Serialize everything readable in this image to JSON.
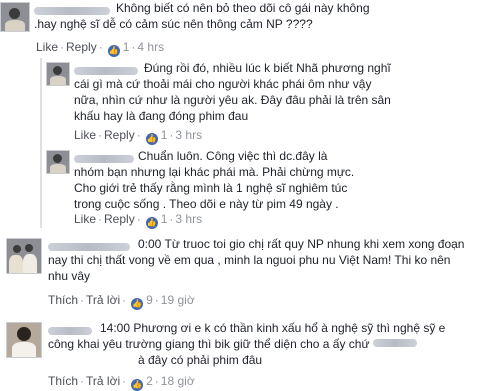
{
  "comments": [
    {
      "text": "Không biết có nên bỏ theo dõi cô gái này không .hay nghệ sĩ dễ có cảm súc nên thông cảm NP ????",
      "like": "Like",
      "reply": "Reply",
      "likes": "1",
      "time": "4 hrs"
    },
    {
      "text": "Đúng rồi đó, nhiều lúc k biết Nhã phương nghĩ cái gì mà cứ thoải mái cho người khác phái ôm như vậy nữa, nhìn cứ như là người yêu ak. Đây đâu phải là trên sân khấu hay là đang đóng phim đau",
      "like": "Like",
      "reply": "Reply",
      "likes": "1",
      "time": "3 hrs"
    },
    {
      "text": "Chuẩn luôn. Công việc thì dc.đây là nhóm bạn nhưng lại khác phái mà. Phải chừng mực. Cho giới trẻ thấy rằng mình là 1 nghệ sĩ nghiêm túc trong cuộc sống . Theo dõi e này từ pim 49 ngày .",
      "like": "Like",
      "reply": "Reply",
      "likes": "1",
      "time": "3 hrs"
    },
    {
      "prefix": "0:00",
      "text": "Từ truoc toi gio chị rất quy NP nhung khi xem xong đoạn nay thi chị thất vong về em qua , minh la nguoi phu nu Việt Nam! Thi ko nên nhu vây",
      "like": "Thích",
      "reply": "Trả lời",
      "likes": "9",
      "time": "19 giờ"
    },
    {
      "prefix": "14:00",
      "text_line1": "Phương ơi e k có thần kinh xấu hổ à nghệ sỹ thì nghệ sỹ e",
      "text_line2": "công khai yêu trường giang thì bik giữ thể diện cho a ấy chứ",
      "text_line3": "à đây có phải phim đâu",
      "like": "Thích",
      "reply": "Trả lời",
      "likes": "2",
      "time": "18 giờ"
    }
  ]
}
